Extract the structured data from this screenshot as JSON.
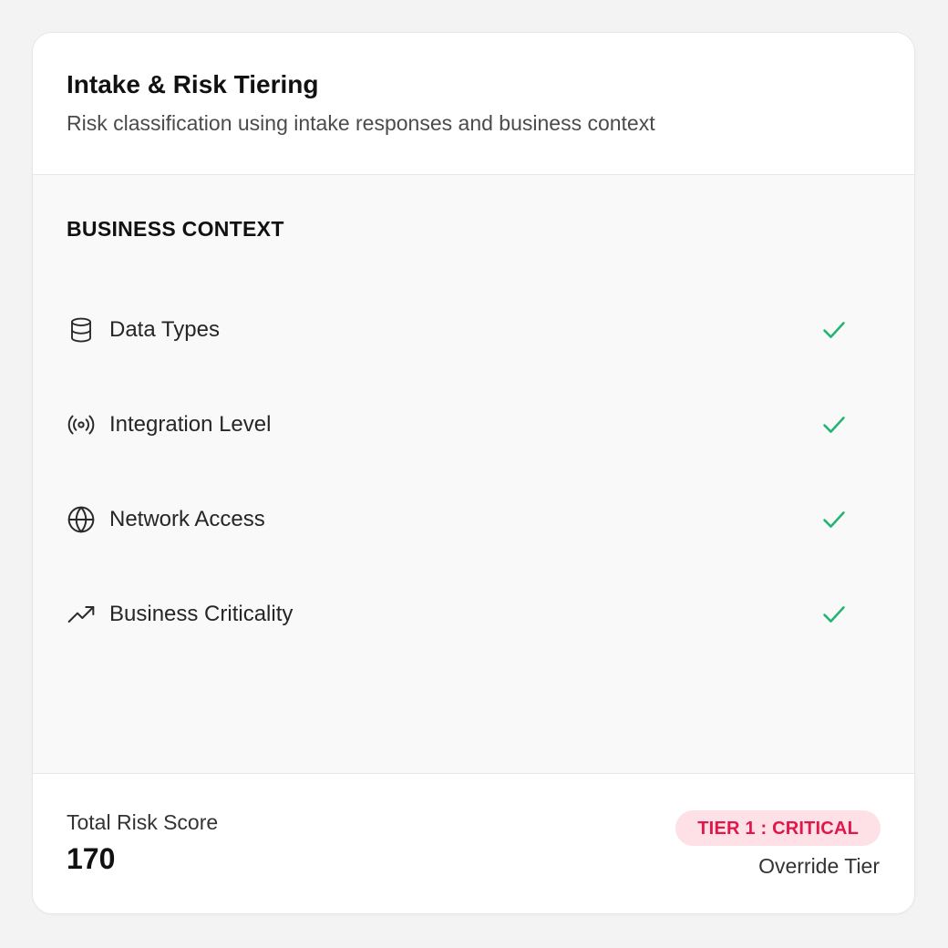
{
  "header": {
    "title": "Intake & Risk Tiering",
    "subtitle": "Risk classification using intake responses and business context"
  },
  "section": {
    "title": "BUSINESS CONTEXT",
    "items": [
      {
        "label": "Data Types",
        "icon": "database-icon",
        "status": "check-icon"
      },
      {
        "label": "Integration Level",
        "icon": "broadcast-icon",
        "status": "check-icon"
      },
      {
        "label": "Network Access",
        "icon": "globe-icon",
        "status": "check-icon"
      },
      {
        "label": "Business Criticality",
        "icon": "trending-up-icon",
        "status": "check-icon"
      }
    ]
  },
  "footer": {
    "score_label": "Total Risk Score",
    "score_value": "170",
    "tier_badge": "TIER 1 : CRITICAL",
    "override_label": "Override Tier"
  },
  "colors": {
    "check": "#22b573",
    "badge_bg": "#fde1e6",
    "badge_text": "#e0174a",
    "panel_bg": "#f9f9f9"
  }
}
